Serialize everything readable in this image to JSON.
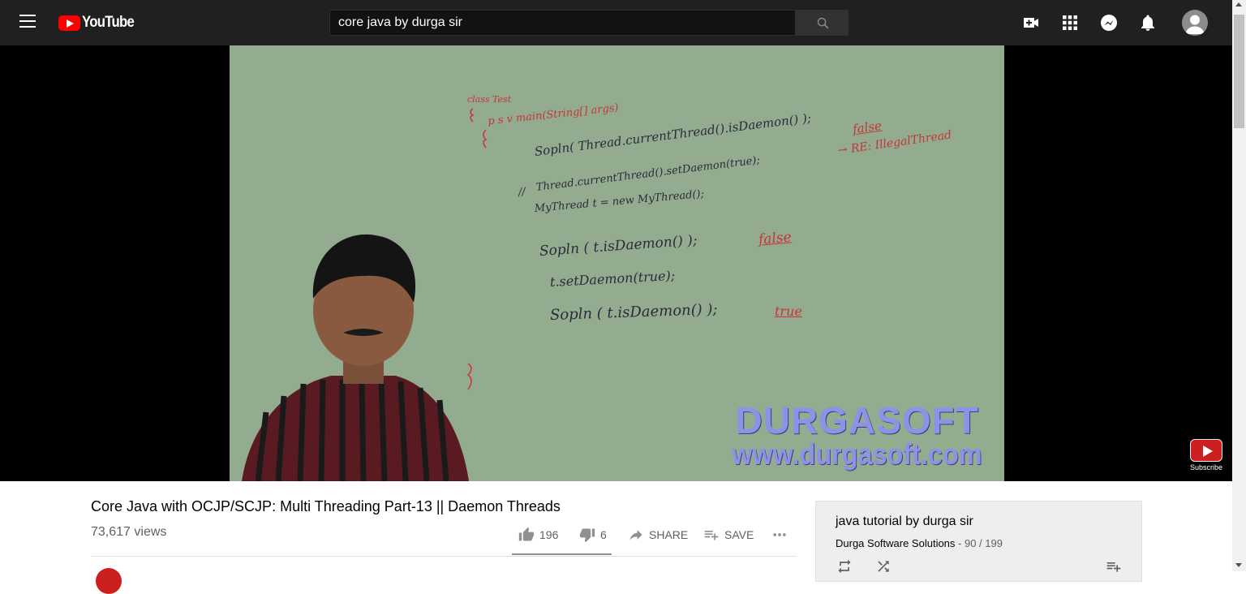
{
  "header": {
    "logo_text": "YouTube",
    "search_value": "core java by durga sir"
  },
  "video": {
    "board": {
      "class_line": "class Test",
      "main_line": "p s v main(String[] args)",
      "line1": "Sopln( Thread.currentThread().isDaemon() );",
      "line1_note": "false",
      "line2": "Thread.currentThread().setDaemon(true);",
      "line2_prefix": "//",
      "line2_note": "→ RE: IllegalThread",
      "line3": "MyThread t = new MyThread();",
      "line4": "Sopln ( t.isDaemon() );",
      "line4_note": "false",
      "line5": "t.setDaemon(true);",
      "line6": "Sopln ( t.isDaemon() );",
      "line6_note": "true"
    },
    "watermark_brand": "DURGASOFT",
    "watermark_url": "www.durgasoft.com",
    "subscribe_label": "Subscribe"
  },
  "info": {
    "title": "Core Java with OCJP/SCJP: Multi Threading Part-13 || Daemon Threads",
    "views": "73,617 views",
    "likes": "196",
    "dislikes": "6",
    "like_ratio": 0.97,
    "share_label": "SHARE",
    "save_label": "SAVE"
  },
  "playlist": {
    "title": "java tutorial by durga sir",
    "channel": "Durga Software Solutions",
    "position": " - 90 / 199"
  },
  "colors": {
    "header_bg": "#202020",
    "brand_red": "#ff0000",
    "board_green": "#93ab8f",
    "marker_red": "#c8343a"
  }
}
